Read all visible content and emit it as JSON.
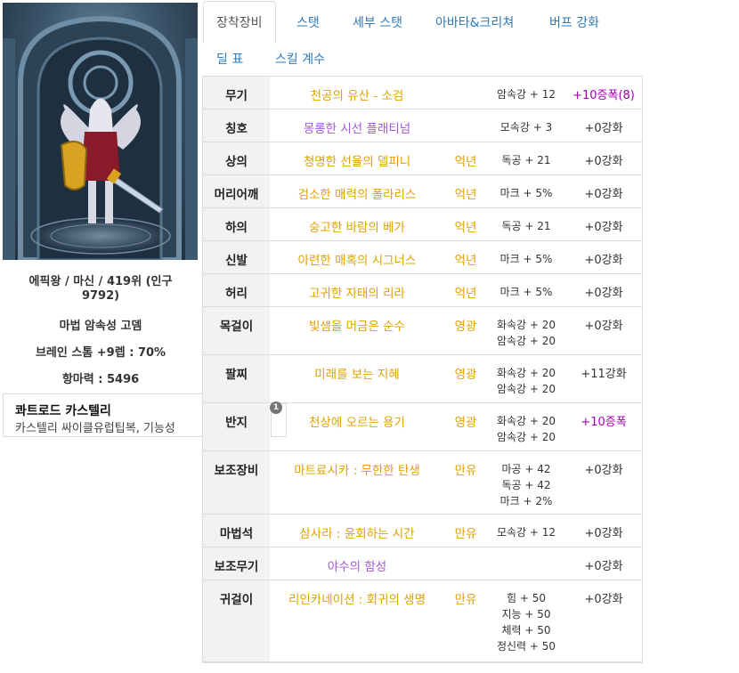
{
  "character": {
    "line1": "에픽왕 / 마신 / 419위 (인구",
    "line2": "9792)",
    "item": "마법 암속성 고뎀",
    "skill": "브레인 스톰 +9렙 : 70%",
    "resist": "항마력 : 5496"
  },
  "title_box": {
    "title": "콰트로드 카스텔리",
    "desc": "카스텔리 싸이클유럽팁복, 기능성"
  },
  "tabs": [
    "장착장비",
    "스탯",
    "세부 스탯",
    "아바타&크리쳐",
    "버프 강화",
    "딜 표",
    "스킬 계수"
  ],
  "equipment": [
    {
      "slot": "무기",
      "name": "천공의 유산 - 소검",
      "color": "gold",
      "grade": "",
      "options": [
        "암속강 + 12"
      ],
      "upgrade": "+10증폭(8)",
      "upgrade_color": "purple"
    },
    {
      "slot": "칭호",
      "name": "몽롱한 시선 플래티넘",
      "color": "purple",
      "grade": "",
      "options": [
        "모속강 + 3"
      ],
      "upgrade": "+0강화",
      "upgrade_color": "normal"
    },
    {
      "slot": "상의",
      "name": "청명한 선율의 델피니",
      "color": "gold",
      "grade": "억년",
      "options": [
        "독공 + 21"
      ],
      "upgrade": "+0강화",
      "upgrade_color": "normal"
    },
    {
      "slot": "머리어깨",
      "name": "검소한 매력의 폴라리스",
      "color": "gold",
      "grade": "억년",
      "options": [
        "마크 + 5%"
      ],
      "upgrade": "+0강화",
      "upgrade_color": "normal"
    },
    {
      "slot": "하의",
      "name": "숭고한 바람의 베가",
      "color": "gold",
      "grade": "억년",
      "options": [
        "독공 + 21"
      ],
      "upgrade": "+0강화",
      "upgrade_color": "normal"
    },
    {
      "slot": "신발",
      "name": "아련한 매혹의 시그너스",
      "color": "gold",
      "grade": "억년",
      "options": [
        "마크 + 5%"
      ],
      "upgrade": "+0강화",
      "upgrade_color": "normal"
    },
    {
      "slot": "허리",
      "name": "고귀한 자태의 리라",
      "color": "gold",
      "grade": "억년",
      "options": [
        "마크 + 5%"
      ],
      "upgrade": "+0강화",
      "upgrade_color": "normal"
    },
    {
      "slot": "목걸이",
      "name": "빛샘을 머금은 순수",
      "color": "gold",
      "grade": "영광",
      "options": [
        "화속강 + 20",
        "암속강 + 20"
      ],
      "upgrade": "+0강화",
      "upgrade_color": "normal"
    },
    {
      "slot": "팔찌",
      "name": "미래를 보는 지혜",
      "color": "gold",
      "grade": "영광",
      "options": [
        "화속강 + 20",
        "암속강 + 20"
      ],
      "upgrade": "+11강화",
      "upgrade_color": "normal"
    },
    {
      "slot": "반지",
      "name": "천상에 오르는 용기",
      "color": "gold",
      "grade": "영광",
      "options": [
        "화속강 + 20",
        "암속강 + 20"
      ],
      "upgrade": "+10증폭",
      "upgrade_color": "purple",
      "badge": "1"
    },
    {
      "slot": "보조장비",
      "name": "마트료시카 : 무한한 탄생",
      "color": "gold",
      "grade": "만유",
      "options": [
        "마공 + 42",
        "독공 + 42",
        "마크 + 2%"
      ],
      "upgrade": "+0강화",
      "upgrade_color": "normal"
    },
    {
      "slot": "마법석",
      "name": "삼사라 : 윤회하는 시간",
      "color": "gold",
      "grade": "만유",
      "options": [
        "모속강 + 12"
      ],
      "upgrade": "+0강화",
      "upgrade_color": "normal"
    },
    {
      "slot": "보조무기",
      "name": "야수의 함성",
      "color": "purple",
      "grade": "",
      "options": [],
      "upgrade": "+0강화",
      "upgrade_color": "normal"
    },
    {
      "slot": "귀걸이",
      "name": "리인카네이션 : 회귀의 생명",
      "color": "gold",
      "grade": "만유",
      "options": [
        "힘 + 50",
        "지능 + 50",
        "체력 + 50",
        "정신력 + 50"
      ],
      "upgrade": "+0강화",
      "upgrade_color": "normal"
    }
  ],
  "icons": {
    "character_art": "character-illustration",
    "badge": "count-badge"
  }
}
